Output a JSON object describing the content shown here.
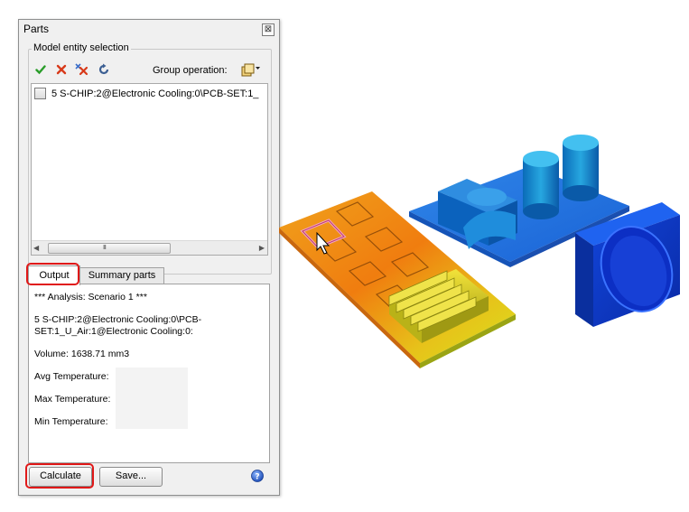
{
  "panel": {
    "title": "Parts",
    "close_glyph": "⊠",
    "group_label": "Model entity selection",
    "group_operation_label": "Group operation:",
    "entity_items": [
      {
        "label": "5 S-CHIP:2@Electronic Cooling:0\\PCB-SET:1_"
      }
    ],
    "scroll_grip": "III",
    "tabs": [
      {
        "label": "Output"
      },
      {
        "label": "Summary parts"
      }
    ],
    "output": {
      "analysis_line": "*** Analysis: Scenario 1 ***",
      "entity_line1": "5 S-CHIP:2@Electronic Cooling:0\\PCB-",
      "entity_line2": "SET:1_U_Air:1@Electronic Cooling:0:",
      "volume_line": "Volume: 1638.71 mm3",
      "avg_label": "Avg Temperature:",
      "max_label": "Max Temperature:",
      "min_label": "Min Temperature:"
    },
    "buttons": {
      "calculate": "Calculate",
      "save": "Save..."
    },
    "icons": [
      "check-icon",
      "remove-icon",
      "remove-all-icon",
      "refresh-icon",
      "group-operation-icon",
      "help-icon"
    ],
    "colors": {
      "highlight": "#e01818",
      "check": "#2a9d2a",
      "remove": "#d83a1a"
    }
  }
}
